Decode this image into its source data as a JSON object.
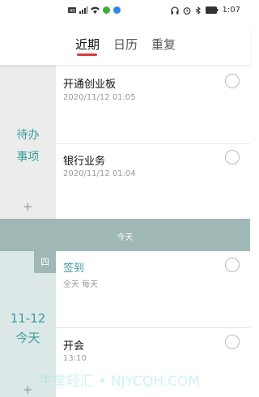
{
  "status_bar": {
    "time": "1:07",
    "left_icons": [
      "hd-icon",
      "signal-icon",
      "wifi-icon",
      "app-notification-icon",
      "app-notification-icon"
    ],
    "right_icons": [
      "headset-icon",
      "alarm-icon",
      "bluetooth-icon",
      "battery-icon"
    ]
  },
  "tabs": [
    {
      "label": "近期",
      "active": true
    },
    {
      "label": "日历",
      "active": false
    },
    {
      "label": "重复",
      "active": false
    }
  ],
  "todo_section": {
    "side_label_line1": "待办",
    "side_label_line2": "事项",
    "add_label": "+",
    "items": [
      {
        "title": "开通创业板",
        "subtitle": "2020/11/12 01:05"
      },
      {
        "title": "银行业务",
        "subtitle": "2020/11/12 01:04"
      }
    ]
  },
  "today_bar": {
    "label": "今天"
  },
  "today_section": {
    "weekday": "四",
    "date": "11-12",
    "date_label": "今天",
    "add_label": "+",
    "items": [
      {
        "title": "签到",
        "subtitle": "全天 每天",
        "accent": true
      },
      {
        "title": "开会",
        "subtitle": "13:10",
        "accent": false
      }
    ]
  },
  "watermark": "牛掌轻汇 • NJYCQH.COM",
  "colors": {
    "accent": "#3a9e9b",
    "tab_underline": "#d73b3b",
    "today_bar": "#9fb8b5",
    "todo_side": "#ececec",
    "today_side": "#dbe8e7"
  }
}
